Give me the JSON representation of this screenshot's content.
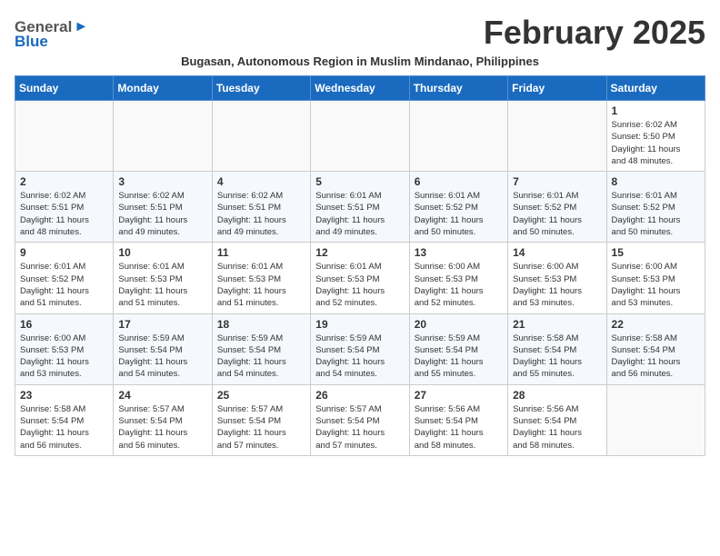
{
  "header": {
    "logo_general": "General",
    "logo_blue": "Blue",
    "month_title": "February 2025",
    "subtitle": "Bugasan, Autonomous Region in Muslim Mindanao, Philippines"
  },
  "weekdays": [
    "Sunday",
    "Monday",
    "Tuesday",
    "Wednesday",
    "Thursday",
    "Friday",
    "Saturday"
  ],
  "weeks": [
    [
      {
        "day": "",
        "info": ""
      },
      {
        "day": "",
        "info": ""
      },
      {
        "day": "",
        "info": ""
      },
      {
        "day": "",
        "info": ""
      },
      {
        "day": "",
        "info": ""
      },
      {
        "day": "",
        "info": ""
      },
      {
        "day": "1",
        "info": "Sunrise: 6:02 AM\nSunset: 5:50 PM\nDaylight: 11 hours\nand 48 minutes."
      }
    ],
    [
      {
        "day": "2",
        "info": "Sunrise: 6:02 AM\nSunset: 5:51 PM\nDaylight: 11 hours\nand 48 minutes."
      },
      {
        "day": "3",
        "info": "Sunrise: 6:02 AM\nSunset: 5:51 PM\nDaylight: 11 hours\nand 49 minutes."
      },
      {
        "day": "4",
        "info": "Sunrise: 6:02 AM\nSunset: 5:51 PM\nDaylight: 11 hours\nand 49 minutes."
      },
      {
        "day": "5",
        "info": "Sunrise: 6:01 AM\nSunset: 5:51 PM\nDaylight: 11 hours\nand 49 minutes."
      },
      {
        "day": "6",
        "info": "Sunrise: 6:01 AM\nSunset: 5:52 PM\nDaylight: 11 hours\nand 50 minutes."
      },
      {
        "day": "7",
        "info": "Sunrise: 6:01 AM\nSunset: 5:52 PM\nDaylight: 11 hours\nand 50 minutes."
      },
      {
        "day": "8",
        "info": "Sunrise: 6:01 AM\nSunset: 5:52 PM\nDaylight: 11 hours\nand 50 minutes."
      }
    ],
    [
      {
        "day": "9",
        "info": "Sunrise: 6:01 AM\nSunset: 5:52 PM\nDaylight: 11 hours\nand 51 minutes."
      },
      {
        "day": "10",
        "info": "Sunrise: 6:01 AM\nSunset: 5:53 PM\nDaylight: 11 hours\nand 51 minutes."
      },
      {
        "day": "11",
        "info": "Sunrise: 6:01 AM\nSunset: 5:53 PM\nDaylight: 11 hours\nand 51 minutes."
      },
      {
        "day": "12",
        "info": "Sunrise: 6:01 AM\nSunset: 5:53 PM\nDaylight: 11 hours\nand 52 minutes."
      },
      {
        "day": "13",
        "info": "Sunrise: 6:00 AM\nSunset: 5:53 PM\nDaylight: 11 hours\nand 52 minutes."
      },
      {
        "day": "14",
        "info": "Sunrise: 6:00 AM\nSunset: 5:53 PM\nDaylight: 11 hours\nand 53 minutes."
      },
      {
        "day": "15",
        "info": "Sunrise: 6:00 AM\nSunset: 5:53 PM\nDaylight: 11 hours\nand 53 minutes."
      }
    ],
    [
      {
        "day": "16",
        "info": "Sunrise: 6:00 AM\nSunset: 5:53 PM\nDaylight: 11 hours\nand 53 minutes."
      },
      {
        "day": "17",
        "info": "Sunrise: 5:59 AM\nSunset: 5:54 PM\nDaylight: 11 hours\nand 54 minutes."
      },
      {
        "day": "18",
        "info": "Sunrise: 5:59 AM\nSunset: 5:54 PM\nDaylight: 11 hours\nand 54 minutes."
      },
      {
        "day": "19",
        "info": "Sunrise: 5:59 AM\nSunset: 5:54 PM\nDaylight: 11 hours\nand 54 minutes."
      },
      {
        "day": "20",
        "info": "Sunrise: 5:59 AM\nSunset: 5:54 PM\nDaylight: 11 hours\nand 55 minutes."
      },
      {
        "day": "21",
        "info": "Sunrise: 5:58 AM\nSunset: 5:54 PM\nDaylight: 11 hours\nand 55 minutes."
      },
      {
        "day": "22",
        "info": "Sunrise: 5:58 AM\nSunset: 5:54 PM\nDaylight: 11 hours\nand 56 minutes."
      }
    ],
    [
      {
        "day": "23",
        "info": "Sunrise: 5:58 AM\nSunset: 5:54 PM\nDaylight: 11 hours\nand 56 minutes."
      },
      {
        "day": "24",
        "info": "Sunrise: 5:57 AM\nSunset: 5:54 PM\nDaylight: 11 hours\nand 56 minutes."
      },
      {
        "day": "25",
        "info": "Sunrise: 5:57 AM\nSunset: 5:54 PM\nDaylight: 11 hours\nand 57 minutes."
      },
      {
        "day": "26",
        "info": "Sunrise: 5:57 AM\nSunset: 5:54 PM\nDaylight: 11 hours\nand 57 minutes."
      },
      {
        "day": "27",
        "info": "Sunrise: 5:56 AM\nSunset: 5:54 PM\nDaylight: 11 hours\nand 58 minutes."
      },
      {
        "day": "28",
        "info": "Sunrise: 5:56 AM\nSunset: 5:54 PM\nDaylight: 11 hours\nand 58 minutes."
      },
      {
        "day": "",
        "info": ""
      }
    ]
  ]
}
